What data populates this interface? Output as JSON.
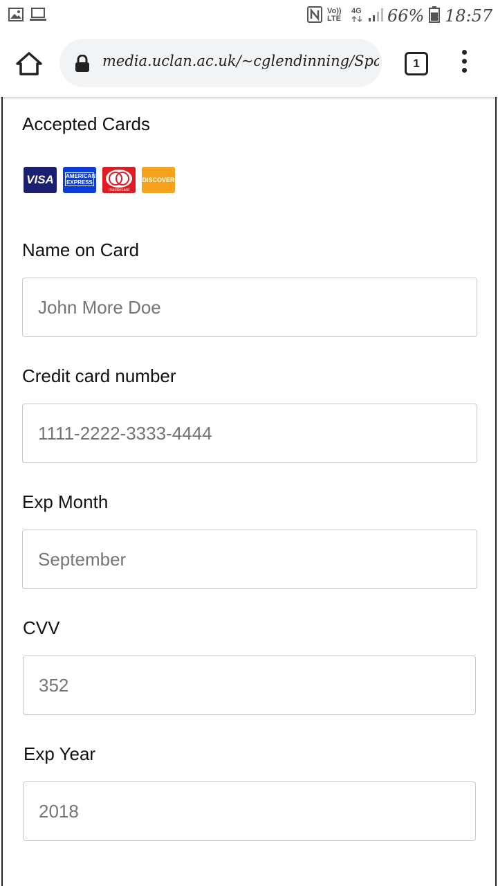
{
  "status_bar": {
    "volte_top": "Vo))",
    "volte_bottom": "LTE",
    "network": "4G",
    "battery": "66%",
    "time": "18:57"
  },
  "browser": {
    "url": "media.uclan.ac.uk/~cglendinning/Spa",
    "tab_count": "1"
  },
  "form": {
    "accepted_cards_label": "Accepted Cards",
    "cards": [
      "VISA",
      "AMERICAN EXPRESS",
      "mastercard",
      "DISCOVER"
    ],
    "name_label": "Name on Card",
    "name_placeholder": "John More Doe",
    "card_number_label": "Credit card number",
    "card_number_placeholder": "1111-2222-3333-4444",
    "exp_month_label": "Exp Month",
    "exp_month_placeholder": "September",
    "cvv_label": "CVV",
    "cvv_placeholder": "352",
    "exp_year_label": "Exp Year",
    "exp_year_placeholder": "2018"
  }
}
